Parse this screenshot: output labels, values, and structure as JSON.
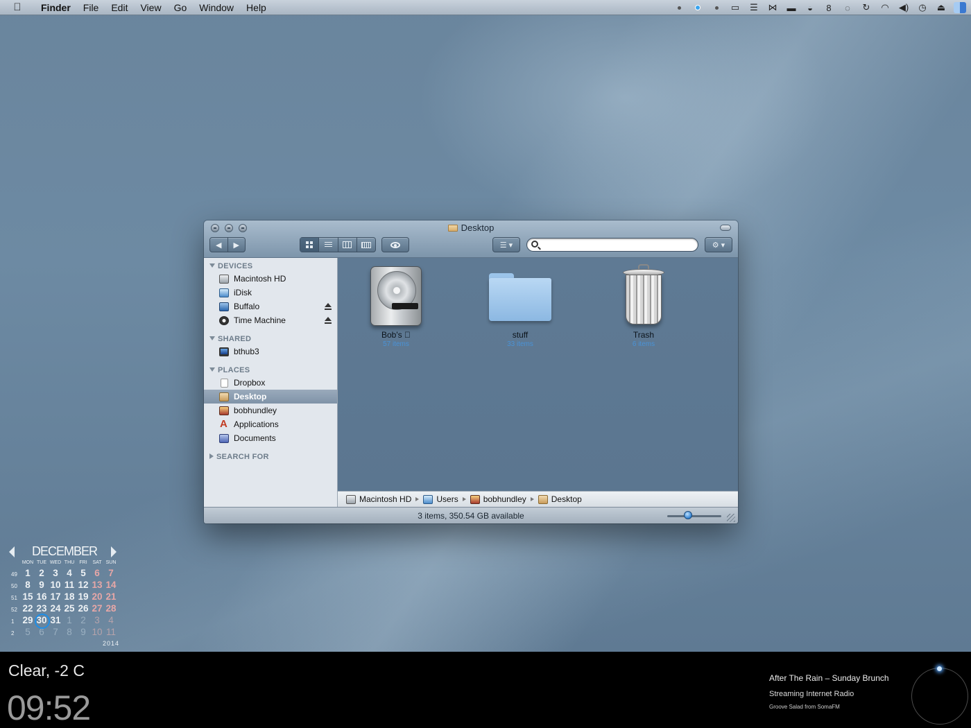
{
  "menubar": {
    "apple_icon": "apple-icon",
    "app_name": "Finder",
    "menus": [
      "File",
      "Edit",
      "View",
      "Go",
      "Window",
      "Help"
    ],
    "status_icons": [
      "dot-icon",
      "blue-dot-icon",
      "dot-icon",
      "terminal-icon",
      "stack-icon",
      "butterfly-icon",
      "display-icon",
      "eye-icon",
      "bowtie-icon",
      "spinner-icon",
      "time-machine-icon",
      "wifi-icon",
      "volume-icon",
      "clock-icon",
      "eject-icon",
      "finder-icon"
    ]
  },
  "window": {
    "title": "Desktop",
    "sidebar": {
      "sections": [
        {
          "title": "DEVICES",
          "items": [
            {
              "label": "Macintosh HD",
              "icon": "hard-drive-icon"
            },
            {
              "label": "iDisk",
              "icon": "idisk-icon"
            },
            {
              "label": "Buffalo",
              "icon": "external-drive-icon",
              "eject": true
            },
            {
              "label": "Time Machine",
              "icon": "time-machine-icon",
              "eject": true
            }
          ]
        },
        {
          "title": "SHARED",
          "items": [
            {
              "label": "bthub3",
              "icon": "monitor-icon"
            }
          ]
        },
        {
          "title": "PLACES",
          "items": [
            {
              "label": "Dropbox",
              "icon": "document-icon"
            },
            {
              "label": "Desktop",
              "icon": "folder-icon",
              "selected": true
            },
            {
              "label": "bobhundley",
              "icon": "home-icon"
            },
            {
              "label": "Applications",
              "icon": "applications-icon"
            },
            {
              "label": "Documents",
              "icon": "documents-icon"
            }
          ]
        },
        {
          "title": "SEARCH FOR",
          "collapsed": true,
          "items": []
        }
      ]
    },
    "files": [
      {
        "name": "Bob's ",
        "info": "57 items",
        "icon": "hard-drive-icon"
      },
      {
        "name": "stuff",
        "info": "33 items",
        "icon": "folder-icon"
      },
      {
        "name": "Trash",
        "info": "6 items",
        "icon": "trash-icon"
      }
    ],
    "path": [
      "Macintosh HD",
      "Users",
      "bobhundley",
      "Desktop"
    ],
    "status_text": "3 items, 350.54 GB available",
    "icon_size_fraction": 0.38,
    "search_value": ""
  },
  "calendar": {
    "month": "DECEMBER",
    "year": "2014",
    "weekdays": [
      "MON",
      "TUE",
      "WED",
      "THU",
      "FRI",
      "SAT",
      "SUN"
    ],
    "weeks": [
      {
        "week": "49",
        "days": [
          "1",
          "2",
          "3",
          "4",
          "5",
          "6",
          "7"
        ]
      },
      {
        "week": "50",
        "days": [
          "8",
          "9",
          "10",
          "11",
          "12",
          "13",
          "14"
        ]
      },
      {
        "week": "51",
        "days": [
          "15",
          "16",
          "17",
          "18",
          "19",
          "20",
          "21"
        ]
      },
      {
        "week": "52",
        "days": [
          "22",
          "23",
          "24",
          "25",
          "26",
          "27",
          "28"
        ]
      },
      {
        "week": "1",
        "days": [
          "29",
          "30",
          "31",
          "1",
          "2",
          "3",
          "4"
        ]
      },
      {
        "week": "2",
        "days": [
          "5",
          "6",
          "7",
          "8",
          "9",
          "10",
          "11"
        ]
      }
    ],
    "today": "30"
  },
  "weather": {
    "text": "Clear, -2 C"
  },
  "clock": {
    "time": "09:52"
  },
  "now_playing": {
    "title": "After The Rain – Sunday Brunch",
    "subtitle": "Streaming Internet Radio",
    "source": "Groove Salad from SomaFM"
  }
}
